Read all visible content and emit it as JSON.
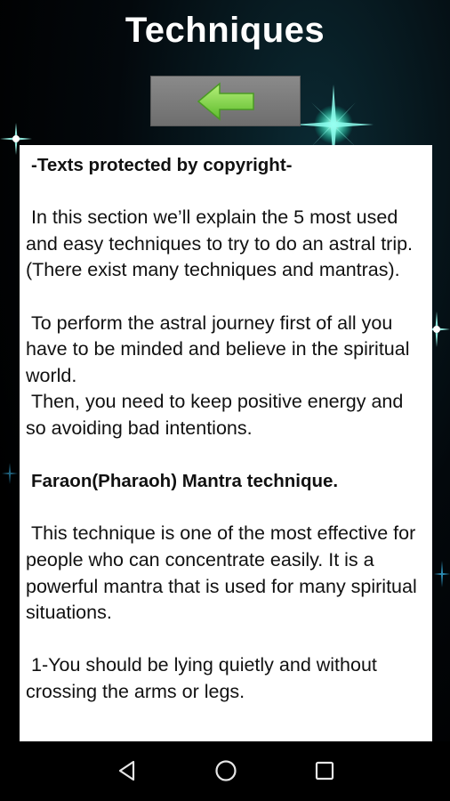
{
  "header": {
    "title": "Techniques"
  },
  "toolbar": {
    "back_icon": "left-arrow-icon",
    "back_color": "#7fd64a"
  },
  "article": {
    "copyright": "-Texts protected by copyright-",
    "intro": "In this section we’ll explain the 5 most used and easy techniques to try to do an astral trip. (There exist many techniques and mantras).",
    "prep_1": "To perform the astral journey first of all you have to be minded and believe in the spiritual world.",
    "prep_2": "Then, you need to keep positive energy and so avoiding bad intentions.",
    "technique_heading": "Faraon(Pharaoh) Mantra technique.",
    "technique_desc": "This technique is one of the most effective for people who can concentrate easily. It is a powerful mantra that is used for many spiritual situations.",
    "step_1": "1-You should be lying quietly and without crossing the arms or legs."
  },
  "navbar": {
    "back_icon": "nav-back-icon",
    "home_icon": "nav-home-icon",
    "recents_icon": "nav-recents-icon"
  }
}
